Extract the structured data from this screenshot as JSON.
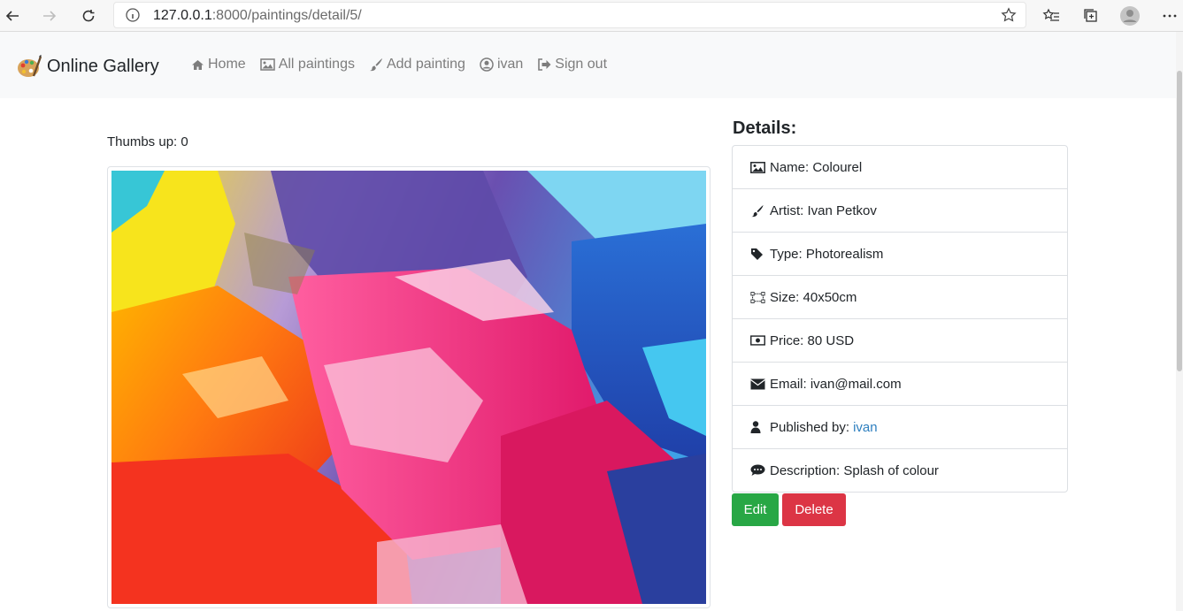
{
  "browser": {
    "url_host": "127.0.0.1",
    "url_rest": ":8000/paintings/detail/5/"
  },
  "navbar": {
    "brand": "Online Gallery",
    "links": [
      {
        "label": "Home",
        "icon": "home-icon"
      },
      {
        "label": "All paintings",
        "icon": "image-icon"
      },
      {
        "label": "Add painting",
        "icon": "brush-icon"
      },
      {
        "label": "ivan",
        "icon": "user-circle-icon"
      },
      {
        "label": "Sign out",
        "icon": "sign-out-icon"
      }
    ]
  },
  "main": {
    "thumbs": "Thumbs up: 0"
  },
  "details": {
    "title": "Details:",
    "name": "Name: Colourel",
    "artist": "Artist: Ivan Petkov",
    "type": "Type: Photorealism",
    "size": "Size: 40x50cm",
    "price": "Price: 80 USD",
    "email": "Email: ivan@mail.com",
    "published_label": "Published by:",
    "published_user": "ivan",
    "description": "Description: Splash of colour"
  },
  "actions": {
    "edit": "Edit",
    "delete": "Delete"
  },
  "colors": {
    "edit": "#28a745",
    "delete": "#dc3545",
    "link": "#2d7fbf",
    "navbar_bg": "#f8f9fa"
  }
}
